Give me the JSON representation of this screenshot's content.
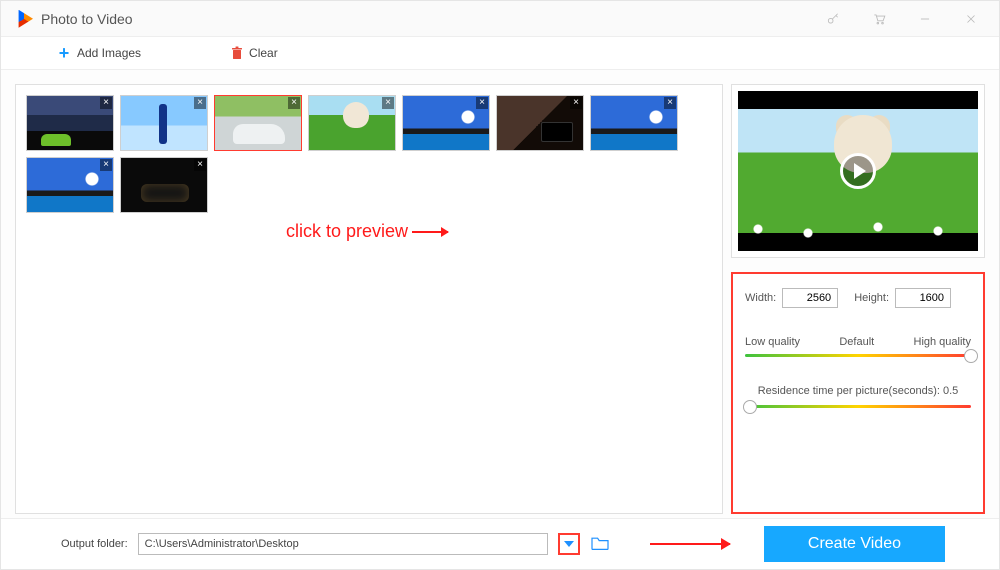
{
  "app": {
    "title": "Photo to Video"
  },
  "toolbar": {
    "add_images": "Add Images",
    "clear": "Clear"
  },
  "thumbnails": [
    {
      "scene": "scene-sky-car",
      "selected": false
    },
    {
      "scene": "scene-blue-bottle",
      "selected": false
    },
    {
      "scene": "scene-white-car",
      "selected": true
    },
    {
      "scene": "scene-rabbit",
      "selected": false
    },
    {
      "scene": "scene-road",
      "selected": false
    },
    {
      "scene": "scene-laptop",
      "selected": false
    },
    {
      "scene": "scene-road",
      "selected": false
    },
    {
      "scene": "scene-road",
      "selected": false
    },
    {
      "scene": "scene-dark-car",
      "selected": false
    }
  ],
  "annotation": {
    "preview_text": "click to preview"
  },
  "settings": {
    "width_label": "Width:",
    "width_value": "2560",
    "height_label": "Height:",
    "height_value": "1600",
    "quality_low": "Low quality",
    "quality_default": "Default",
    "quality_high": "High quality",
    "quality_knob_pct": 100,
    "residence_label": "Residence time per picture(seconds): 0.5",
    "residence_knob_pct": 2
  },
  "footer": {
    "output_label": "Output folder:",
    "output_value": "C:\\Users\\Administrator\\Desktop",
    "create_label": "Create Video"
  }
}
